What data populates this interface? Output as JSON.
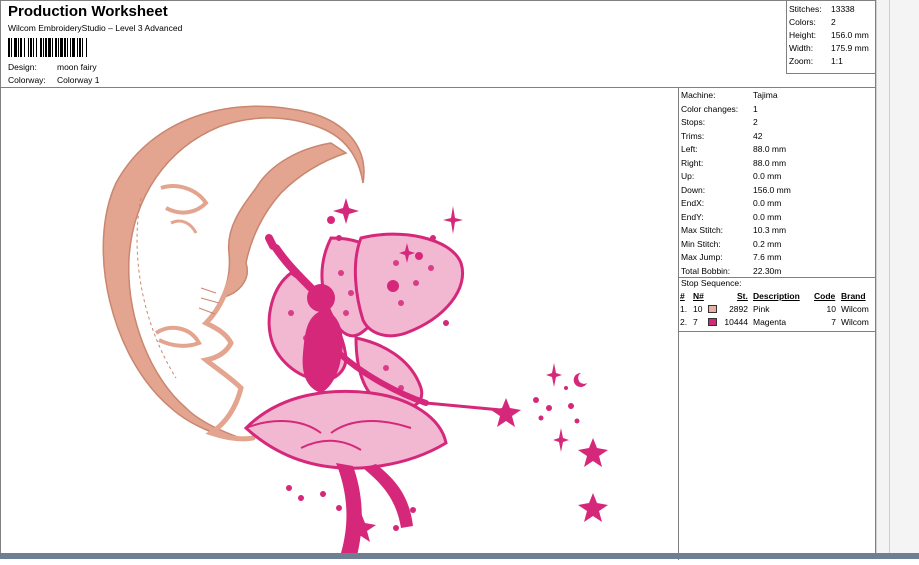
{
  "header": {
    "title": "Production Worksheet",
    "subtitle": "Wilcom EmbroideryStudio – Level 3 Advanced",
    "design_label": "Design:",
    "design_value": "moon fairy",
    "colorway_label": "Colorway:",
    "colorway_value": "Colorway 1"
  },
  "stats": {
    "stitches_label": "Stitches:",
    "stitches_value": "13338",
    "colors_label": "Colors:",
    "colors_value": "2",
    "height_label": "Height:",
    "height_value": "156.0 mm",
    "width_label": "Width:",
    "width_value": "175.9 mm",
    "zoom_label": "Zoom:",
    "zoom_value": "1:1"
  },
  "machine_info": [
    {
      "label": "Machine:",
      "value": "Tajima"
    },
    {
      "label": "Color changes:",
      "value": "1"
    },
    {
      "label": "Stops:",
      "value": "2"
    },
    {
      "label": "Trims:",
      "value": "42"
    },
    {
      "label": "Left:",
      "value": "88.0 mm"
    },
    {
      "label": "Right:",
      "value": "88.0 mm"
    },
    {
      "label": "Up:",
      "value": "0.0 mm"
    },
    {
      "label": "Down:",
      "value": "156.0 mm"
    },
    {
      "label": "EndX:",
      "value": "0.0 mm"
    },
    {
      "label": "EndY:",
      "value": "0.0 mm"
    },
    {
      "label": "Max Stitch:",
      "value": "10.3 mm"
    },
    {
      "label": "Min Stitch:",
      "value": "0.2 mm"
    },
    {
      "label": "Max Jump:",
      "value": "7.6 mm"
    },
    {
      "label": "Total Bobbin:",
      "value": "22.30m"
    }
  ],
  "stop_sequence": {
    "title": "Stop Sequence:",
    "headers": {
      "num": "#",
      "needle": "N#",
      "stitches": "St.",
      "description": "Description",
      "code": "Code",
      "brand": "Brand"
    },
    "rows": [
      {
        "num": "1.",
        "needle": "10",
        "color": "#e8b0a0",
        "stitches": "2892",
        "description": "Pink",
        "code": "10",
        "brand": "Wilcom"
      },
      {
        "num": "2.",
        "needle": "7",
        "color": "#d6287a",
        "stitches": "10444",
        "description": "Magenta",
        "code": "7",
        "brand": "Wilcom"
      }
    ]
  },
  "colors": {
    "moon": "#e3a58f",
    "moon_dark": "#c98670",
    "fairy": "#d6287a",
    "fairy_dark": "#a81c5e"
  }
}
